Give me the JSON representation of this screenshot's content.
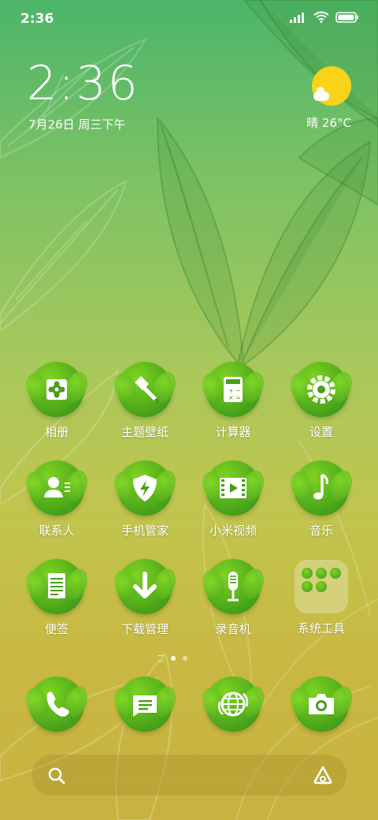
{
  "status_bar": {
    "time": "2:36",
    "icons": [
      "signal-icon",
      "wifi-icon",
      "battery-icon"
    ]
  },
  "clock_widget": {
    "time": "2:36",
    "date": "7月26日 周三下午"
  },
  "weather_widget": {
    "text": "晴 26°C",
    "icon": "sunny-cloud-icon"
  },
  "apps": [
    {
      "label": "相册",
      "icon": "gallery-icon"
    },
    {
      "label": "主题壁纸",
      "icon": "themes-brush-icon"
    },
    {
      "label": "计算器",
      "icon": "calculator-icon"
    },
    {
      "label": "设置",
      "icon": "settings-gear-icon"
    },
    {
      "label": "联系人",
      "icon": "contacts-icon"
    },
    {
      "label": "手机管家",
      "icon": "security-shield-icon"
    },
    {
      "label": "小米视频",
      "icon": "video-icon"
    },
    {
      "label": "音乐",
      "icon": "music-note-icon"
    },
    {
      "label": "便签",
      "icon": "notes-icon"
    },
    {
      "label": "下载管理",
      "icon": "download-icon"
    },
    {
      "label": "录音机",
      "icon": "microphone-icon"
    },
    {
      "label": "系统工具",
      "icon": "folder-icon"
    }
  ],
  "page_indicator": {
    "pages": 2,
    "active": 1
  },
  "dock": [
    {
      "icon": "phone-icon"
    },
    {
      "icon": "messages-icon"
    },
    {
      "icon": "browser-icon"
    },
    {
      "icon": "camera-icon"
    }
  ],
  "search_bar": {
    "left_icon": "search-icon",
    "right_icon": "assistant-icon"
  },
  "colors": {
    "icon_green": "#5fb81c",
    "sun_yellow": "#f9d21a"
  }
}
